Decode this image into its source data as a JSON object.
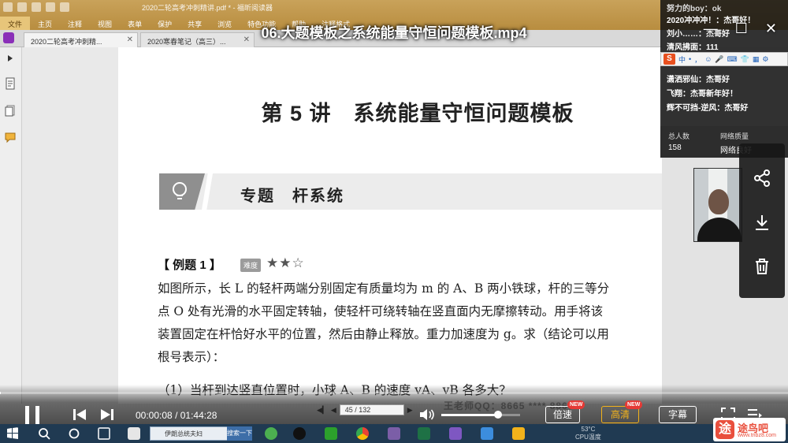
{
  "video": {
    "title": "06.大题模板之系统能量守恒问题模板.mp4",
    "time_current": "00:00:08",
    "time_total": "01:44:28",
    "progress_fraction": 0.0013,
    "volume_fraction": 0.72,
    "speed_label": "倍速",
    "quality_label": "高清",
    "subtitle_label": "字幕",
    "new_badge": "NEW",
    "watermark": "王老师QQ：8665 **** 8866"
  },
  "office": {
    "ribbon_tabs": [
      "文件",
      "主页",
      "注释",
      "视图",
      "表单",
      "保护",
      "共享",
      "浏览",
      "特色功能",
      "帮助",
      "注释格式"
    ],
    "doc_title": "2020二轮高考冲刺精讲.pdf * - 福昕阅读器"
  },
  "doc_tabs": [
    {
      "label": "2020二轮高考冲刺精..."
    },
    {
      "label": "2020寒春笔记（高三）..."
    }
  ],
  "document": {
    "lesson_title": "第 5 讲　系统能量守恒问题模板",
    "topic": "专题　杆系统",
    "example_head": "【 例题 1 】",
    "difficulty_tag": "难度",
    "stars": "★★☆",
    "problem_lines": [
      "如图所示，长 L 的轻杆两端分别固定有质量均为 m 的 A、B 两小铁球，杆的三等分",
      "点 O 处有光滑的水平固定转轴，使轻杆可绕转轴在竖直面内无摩擦转动。用手将该",
      "装置固定在杆恰好水平的位置，然后由静止释放。重力加速度为 g。求（结论可以用",
      "根号表示）："
    ],
    "question_1": "（1）当杆到达竖直位置时，小球 A、B 的速度 vA、vB 各多大？"
  },
  "pdf_nav": {
    "page": "45 / 132"
  },
  "chat": {
    "lines": [
      "努力的boy：ok",
      "2020冲冲冲！：杰哥好！",
      "刘小……：杰哥好",
      "清风拂面：111",
      "潇洒邪仙：杰哥好",
      "飞翔：杰哥新年好！",
      "辉不可挡-逆风：杰哥好"
    ],
    "ime_items": [
      "中",
      "•",
      "，",
      "☺",
      "🎤",
      "⌨",
      "👕",
      "▦",
      "⚙"
    ],
    "stats": {
      "viewers_label": "总人数",
      "viewers_value": "158",
      "network_label": "网络质量",
      "network_value": "网络良好"
    }
  },
  "taskbar": {
    "search_text": "伊朗总统夫妇",
    "search_button": "搜索一下",
    "temp": "53°C",
    "temp_label": "CPU温度"
  },
  "brand": {
    "logo_char": "途",
    "name": "途鸟吧",
    "url": "www.tnbz8.com"
  },
  "colors": {
    "ribbon": "#c49a4e",
    "highlight": "#f2b21b",
    "new_badge": "#e53935",
    "taskbar": "#203a52"
  }
}
